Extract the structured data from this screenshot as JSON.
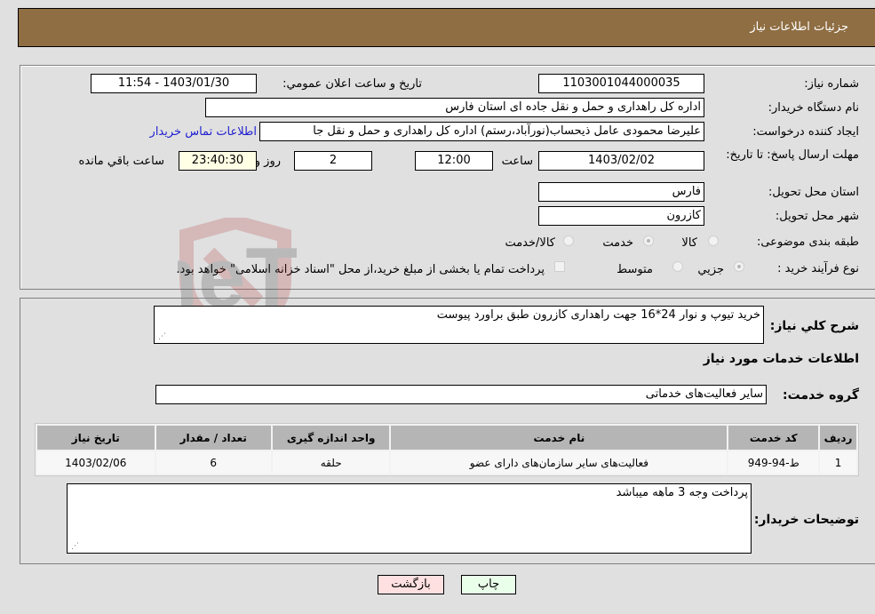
{
  "header": {
    "title": "جزئیات اطلاعات نیاز"
  },
  "details": {
    "need_number": {
      "label": "شماره نیاز:",
      "value": "1103001044000035"
    },
    "announce_datetime": {
      "label": "تاریخ و ساعت اعلان عمومي:",
      "value": "1403/01/30 - 11:54"
    },
    "buyer_org": {
      "label": "نام دستگاه خریدار:",
      "value": "اداره کل راهداری و حمل و نقل جاده ای استان فارس"
    },
    "requester": {
      "label": "ایجاد کننده درخواست:",
      "value": "علیرضا محمودی عامل ذیحساب(نورآباد،رستم) اداره کل راهداری و حمل و نقل جا"
    },
    "buyer_contact_link": "اطلاعات تماس خریدار",
    "deadline": {
      "label": "مهلت ارسال پاسخ: تا تاریخ:",
      "date": "1403/02/02",
      "time_label": "ساعت",
      "time": "12:00",
      "days": "2",
      "days_label": "روز و",
      "remaining": "23:40:30",
      "remaining_label": "ساعت باقي مانده"
    },
    "delivery_province": {
      "label": "استان محل تحویل:",
      "value": "فارس"
    },
    "delivery_city": {
      "label": "شهر محل تحویل:",
      "value": "کازرون"
    },
    "category": {
      "label": "طبقه بندی موضوعی:",
      "options": [
        "کالا",
        "خدمت",
        "کالا/خدمت"
      ],
      "selected": "خدمت"
    },
    "purchase_type": {
      "label": "نوع فرآیند خرید :",
      "options": [
        "جزيي",
        "متوسط"
      ],
      "selected": "جزيي",
      "treasury_note": "پرداخت تمام یا بخشی از مبلغ خرید،از محل \"اسناد خزانه اسلامی\" خواهد بود."
    }
  },
  "summary": {
    "label": "شرح کلي نياز:",
    "value": "خرید تیوپ و نوار 24*16 جهت راهداری کازرون طبق براورد پیوست"
  },
  "services": {
    "section_title": "اطلاعات خدمات مورد نياز",
    "group_label": "گروه خدمت:",
    "group_value": "سایر فعالیت‌های خدماتی",
    "table": {
      "headers": [
        "ردیف",
        "کد خدمت",
        "نام خدمت",
        "واحد اندازه گیری",
        "تعداد / مقدار",
        "تاریخ نیاز"
      ],
      "rows": [
        [
          "1",
          "ط-94-949",
          "فعالیت‌های سایر سازمان‌های دارای عضو",
          "حلقه",
          "6",
          "1403/02/06"
        ]
      ]
    }
  },
  "buyer_notes": {
    "label": "توضیحات خریدار:",
    "value": "پرداخت وجه 3 ماهه میباشد"
  },
  "buttons": {
    "print": "چاپ",
    "back": "بازگشت"
  },
  "watermark": "AriaTender.neT",
  "colors": {
    "header_bg": "#8f6e43",
    "print_bg": "#eaffea",
    "back_bg": "#ffe0e0",
    "link": "#2020d0",
    "remaining_bg": "#ffffe5"
  }
}
